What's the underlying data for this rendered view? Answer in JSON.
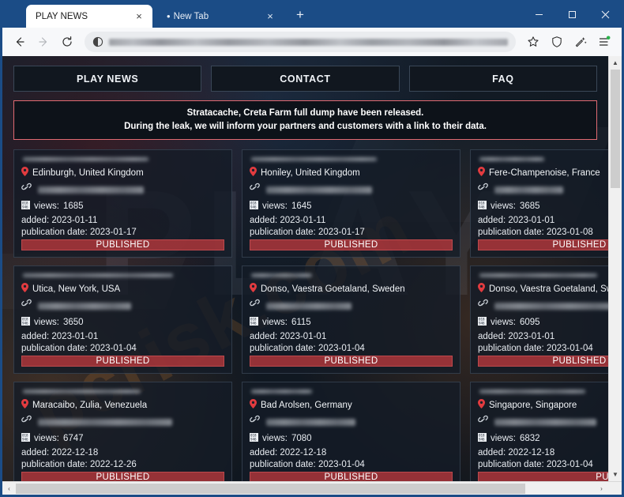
{
  "browser": {
    "tabs": [
      {
        "label": "PLAY NEWS",
        "close": "×",
        "active": true
      },
      {
        "label": "New Tab",
        "close": "×",
        "active": false,
        "dot": "•"
      }
    ],
    "new_tab_label": "+",
    "window_controls": {
      "minimize": "minimize-icon",
      "maximize": "maximize-icon",
      "close": "close-icon"
    },
    "toolbar": {
      "back": "back-arrow-icon",
      "forward": "forward-arrow-icon",
      "reload": "reload-icon",
      "site_info": "site-info-icon",
      "address_value": "",
      "address_placeholder": "",
      "favorites": "star-icon",
      "shield": "shield-icon",
      "collections": "collections-icon",
      "settings": "settings-menu-icon"
    }
  },
  "site": {
    "watermark_big": "PLAY",
    "watermark_diagonal": "pcrisk.com",
    "nav": [
      {
        "label": "PLAY NEWS"
      },
      {
        "label": "CONTACT"
      },
      {
        "label": "FAQ"
      }
    ],
    "banner": {
      "line1": "Stratacache, Creta Farm full dump have been released.",
      "line2": "During the leak, we will inform your partners and customers with a link to their data.",
      "border_color": "#e06a72"
    },
    "labels": {
      "views": "views:",
      "added": "added:",
      "publication_date": "publication date:"
    },
    "accent_color": "#c43a3e",
    "cards": [
      {
        "title_redacted": true,
        "location": "Edinburgh, United Kingdom",
        "link_redacted": true,
        "views": "1685",
        "added": "2023-01-11",
        "publication_date": "2023-01-17",
        "status": "PUBLISHED"
      },
      {
        "title_redacted": true,
        "location": "Honiley, United Kingdom",
        "link_redacted": true,
        "views": "1645",
        "added": "2023-01-11",
        "publication_date": "2023-01-17",
        "status": "PUBLISHED"
      },
      {
        "title_redacted": true,
        "location": "Fere-Champenoise, France",
        "link_redacted": true,
        "views": "3685",
        "added": "2023-01-01",
        "publication_date": "2023-01-08",
        "status": "PUBLISHED"
      },
      {
        "title_redacted": true,
        "location": "Utica, New York, USA",
        "link_redacted": true,
        "views": "3650",
        "added": "2023-01-01",
        "publication_date": "2023-01-04",
        "status": "PUBLISHED"
      },
      {
        "title_redacted": true,
        "location": "Donso, Vaestra Goetaland, Sweden",
        "link_redacted": true,
        "views": "6115",
        "added": "2023-01-01",
        "publication_date": "2023-01-04",
        "status": "PUBLISHED"
      },
      {
        "title_redacted": true,
        "location": "Donso, Vaestra Goetaland, Sweden",
        "link_redacted": true,
        "views": "6095",
        "added": "2023-01-01",
        "publication_date": "2023-01-04",
        "status": "PUBLISHED"
      },
      {
        "title_redacted": true,
        "location": "Maracaibo, Zulia, Venezuela",
        "link_redacted": true,
        "views": "6747",
        "added": "2022-12-18",
        "publication_date": "2022-12-26",
        "status": "PUBLISHED"
      },
      {
        "title_redacted": true,
        "location": "Bad Arolsen, Germany",
        "link_redacted": true,
        "views": "7080",
        "added": "2022-12-18",
        "publication_date": "2023-01-04",
        "status": "PUBLISHED"
      },
      {
        "title_redacted": true,
        "location": "Singapore, Singapore",
        "link_redacted": true,
        "views": "6832",
        "added": "2022-12-18",
        "publication_date": "2023-01-04",
        "status": "PUBLISHED FULL"
      }
    ]
  },
  "scrollbars": {
    "vertical": {
      "up": "▲",
      "down": "▼"
    },
    "horizontal": {
      "left": "‹",
      "right": "›"
    }
  }
}
